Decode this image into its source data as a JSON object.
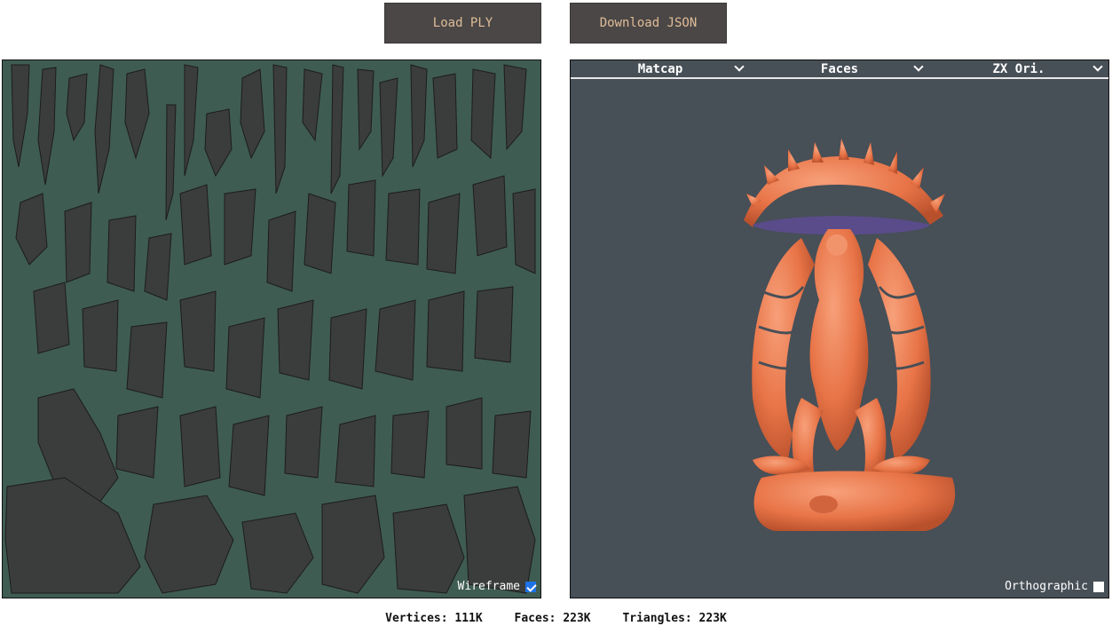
{
  "toolbar": {
    "load_label": "Load PLY",
    "download_label": "Download JSON"
  },
  "uv_panel": {
    "wireframe_label": "Wireframe",
    "wireframe_checked": true
  },
  "view_panel": {
    "shading_select": "Matcap",
    "mode_select": "Faces",
    "orientation_select": "ZX Ori.",
    "orthographic_label": "Orthographic",
    "orthographic_checked": false
  },
  "stats": {
    "vertices": "Vertices: 111K",
    "faces": "Faces: 223K",
    "triangles": "Triangles: 223K"
  },
  "colors": {
    "uv_background": "#3f5c52",
    "view_background": "#474f57",
    "model": "#e87447",
    "button_bg": "#4a4746",
    "button_text": "#e0bc98"
  }
}
